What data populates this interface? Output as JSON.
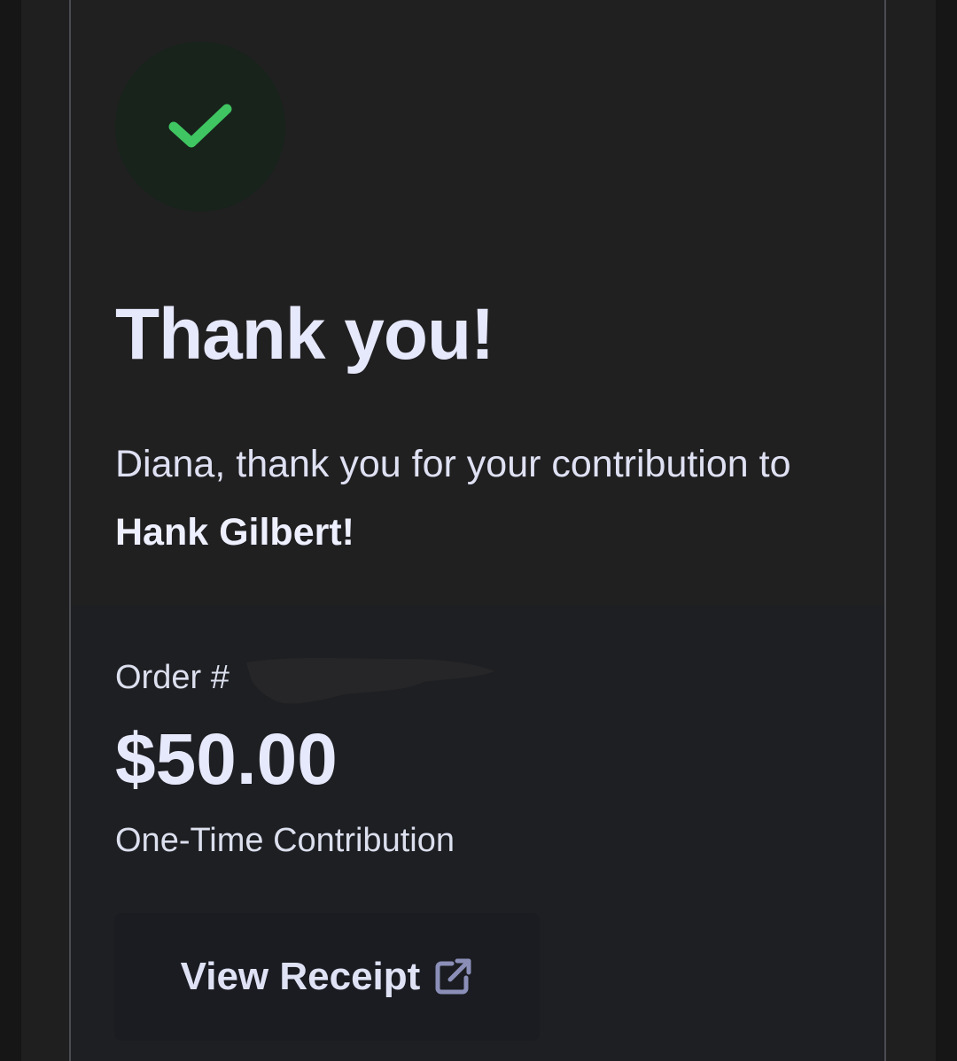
{
  "confirmation": {
    "headline": "Thank you!",
    "message_prefix": "Diana, thank you for your contribution to ",
    "recipient": "Hank Gilbert",
    "message_suffix": "!"
  },
  "order": {
    "label": "Order #",
    "amount": "$50.00",
    "type": "One-Time Contribution"
  },
  "actions": {
    "view_receipt_label": "View Receipt"
  },
  "icons": {
    "success": "checkmark-icon",
    "receipt_link": "external-link-icon"
  },
  "colors": {
    "success_green": "#3fc561",
    "badge_background": "#17231b",
    "text_primary": "#e6e8fb",
    "icon_muted": "#8b8fb8"
  }
}
